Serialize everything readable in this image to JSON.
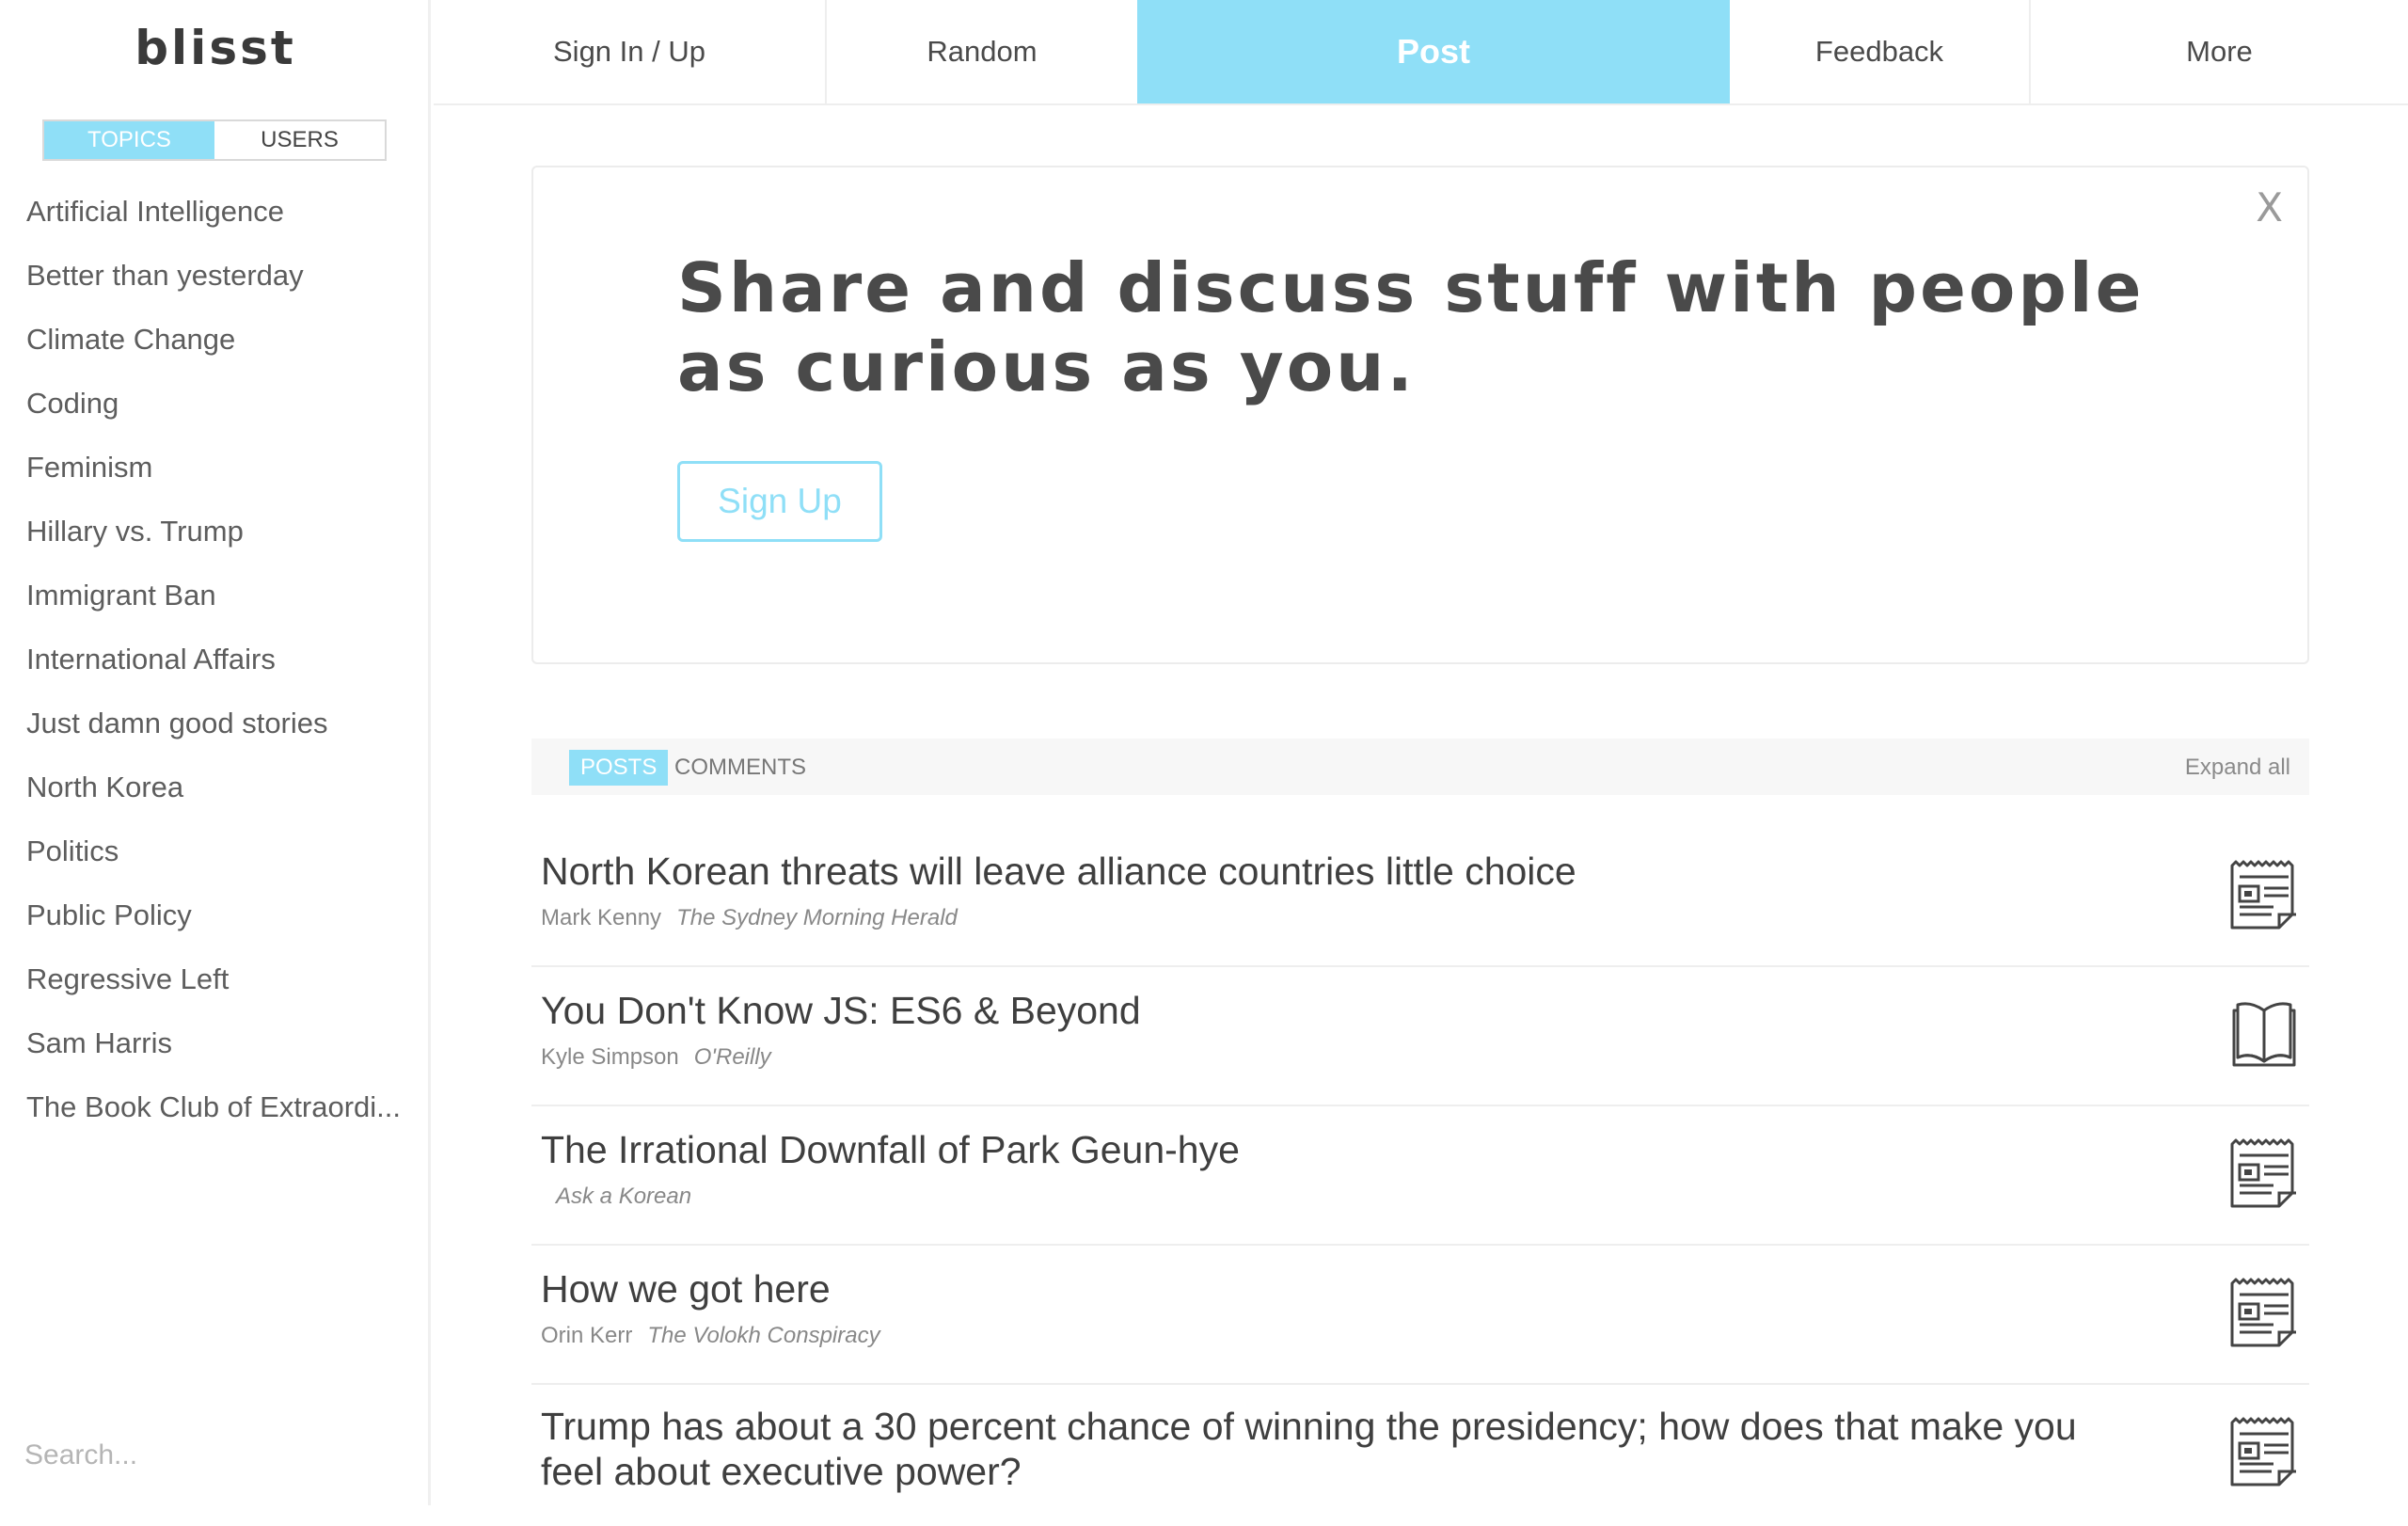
{
  "sidebar": {
    "logo": "blisst",
    "toggle": {
      "topics": "TOPICS",
      "users": "USERS",
      "active": "topics"
    },
    "topics": [
      "Artificial Intelligence",
      "Better than yesterday",
      "Climate Change",
      "Coding",
      "Feminism",
      "Hillary vs. Trump",
      "Immigrant Ban",
      "International Affairs",
      "Just damn good stories",
      "North Korea",
      "Politics",
      "Public Policy",
      "Regressive Left",
      "Sam Harris",
      "The Book Club of Extraordi..."
    ],
    "search_placeholder": "Search..."
  },
  "nav": {
    "signin": "Sign In / Up",
    "random": "Random",
    "post": "Post",
    "feedback": "Feedback",
    "more": "More"
  },
  "hero": {
    "headline": "Share and discuss stuff with people as curious as you.",
    "signup": "Sign Up",
    "close": "X"
  },
  "feed": {
    "tab_posts": "POSTS",
    "tab_comments": "COMMENTS",
    "active_tab": "posts",
    "expand": "Expand all"
  },
  "posts": [
    {
      "title": "North Korean threats will leave alliance countries little choice",
      "author": "Mark Kenny",
      "source": "The Sydney Morning Herald",
      "icon": "newspaper-icon"
    },
    {
      "title": "You Don't Know JS: ES6 & Beyond",
      "author": "Kyle Simpson",
      "source": "O'Reilly",
      "icon": "book-icon"
    },
    {
      "title": "The Irrational Downfall of Park Geun-hye",
      "author": "",
      "source": "Ask a Korean",
      "icon": "newspaper-icon"
    },
    {
      "title": "How we got here",
      "author": "Orin Kerr",
      "source": "The Volokh Conspiracy",
      "icon": "newspaper-icon"
    },
    {
      "title": "Trump has about a 30 percent chance of winning the presidency; how does that make you feel about executive power?",
      "author": "",
      "source": "",
      "icon": "newspaper-icon"
    }
  ],
  "colors": {
    "accent": "#8fdff7",
    "text": "#4a4a4a",
    "muted": "#888888"
  }
}
